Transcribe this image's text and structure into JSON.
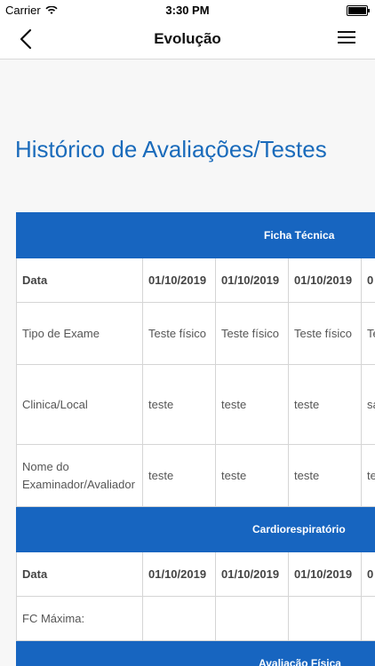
{
  "status_bar": {
    "carrier": "Carrier",
    "time": "3:30 PM"
  },
  "nav": {
    "title": "Evolução"
  },
  "page": {
    "heading": "Histórico de Avaliações/Testes"
  },
  "table": {
    "sections": [
      {
        "title": "Ficha Técnica",
        "rows": [
          {
            "label": "Data",
            "bold": true,
            "cells": [
              "01/10/2019",
              "01/10/2019",
              "01/10/2019",
              "0"
            ]
          },
          {
            "label": "Tipo de Exame",
            "cells": [
              "Teste físico",
              "Teste físico",
              "Teste físico",
              "Te"
            ]
          },
          {
            "label": "Clinica/Local",
            "cells": [
              "teste",
              "teste",
              "teste",
              "sa"
            ]
          },
          {
            "label": "Nome do Examinador/Avaliador",
            "cells": [
              "teste",
              "teste",
              "teste",
              "te"
            ]
          }
        ]
      },
      {
        "title": "Cardiorespiratório",
        "rows": [
          {
            "label": "Data",
            "bold": true,
            "cells": [
              "01/10/2019",
              "01/10/2019",
              "01/10/2019",
              "0"
            ]
          },
          {
            "label": "FC Máxima:",
            "cells": [
              "",
              "",
              "",
              ""
            ]
          }
        ]
      },
      {
        "title": "Avaliação Física",
        "rows": []
      }
    ]
  }
}
